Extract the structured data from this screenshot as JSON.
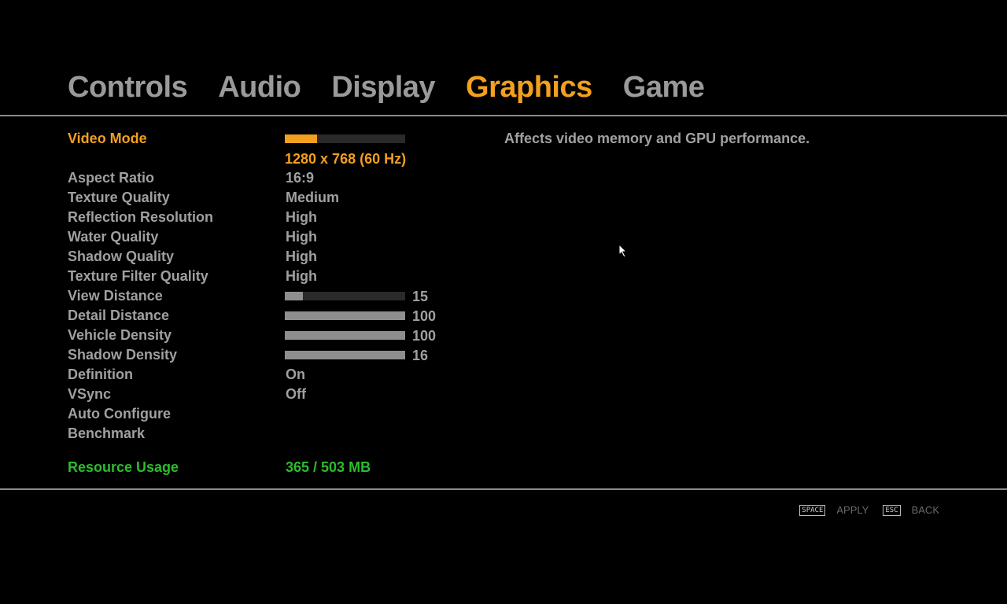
{
  "tabs": [
    {
      "label": "Controls",
      "active": false
    },
    {
      "label": "Audio",
      "active": false
    },
    {
      "label": "Display",
      "active": false
    },
    {
      "label": "Graphics",
      "active": true
    },
    {
      "label": "Game",
      "active": false
    }
  ],
  "description": "Affects video memory and GPU performance.",
  "video_mode": {
    "label": "Video Mode",
    "level": 0.27,
    "value": "1280 x 768 (60 Hz)"
  },
  "settings": {
    "aspect_ratio": {
      "label": "Aspect Ratio",
      "value": "16:9"
    },
    "texture_quality": {
      "label": "Texture Quality",
      "value": "Medium"
    },
    "reflection_resolution": {
      "label": "Reflection Resolution",
      "value": "High"
    },
    "water_quality": {
      "label": "Water Quality",
      "value": "High"
    },
    "shadow_quality": {
      "label": "Shadow Quality",
      "value": "High"
    },
    "texture_filter_quality": {
      "label": "Texture Filter Quality",
      "value": "High"
    },
    "view_distance": {
      "label": "View Distance",
      "value": "15",
      "level": 0.15
    },
    "detail_distance": {
      "label": "Detail Distance",
      "value": "100",
      "level": 1.0
    },
    "vehicle_density": {
      "label": "Vehicle Density",
      "value": "100",
      "level": 1.0
    },
    "shadow_density": {
      "label": "Shadow Density",
      "value": "16",
      "level": 1.0
    },
    "definition": {
      "label": "Definition",
      "value": "On"
    },
    "vsync": {
      "label": "VSync",
      "value": "Off"
    },
    "auto_configure": {
      "label": "Auto Configure"
    },
    "benchmark": {
      "label": "Benchmark"
    }
  },
  "resource_usage": {
    "label": "Resource Usage",
    "value": "365 / 503 MB"
  },
  "footer": {
    "apply_key": "SPACE",
    "apply_label": "APPLY",
    "back_key": "ESC",
    "back_label": "BACK"
  },
  "colors": {
    "accent": "#f2a01e",
    "text": "#a0a0a0",
    "resource": "#2cbc2c",
    "background": "#000000"
  }
}
